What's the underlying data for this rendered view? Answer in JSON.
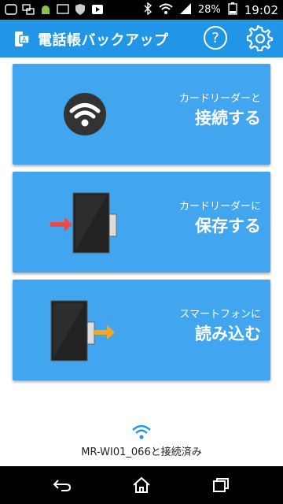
{
  "status_bar": {
    "battery_percent": "28%",
    "time": "19:02"
  },
  "app_bar": {
    "title": "電話帳バックアップ",
    "help_label": "?"
  },
  "cards": [
    {
      "sub": "カードリーダーと",
      "main": "接続する"
    },
    {
      "sub": "カードリーダーに",
      "main": "保存する"
    },
    {
      "sub": "スマートフォンに",
      "main": "読み込む"
    }
  ],
  "footer": {
    "connection_status": "MR-WI01_066と接続済み"
  },
  "colors": {
    "primary": "#2196e6",
    "card": "#42a5f0",
    "arrow_red": "#e84a4a",
    "arrow_orange": "#f5a623"
  }
}
